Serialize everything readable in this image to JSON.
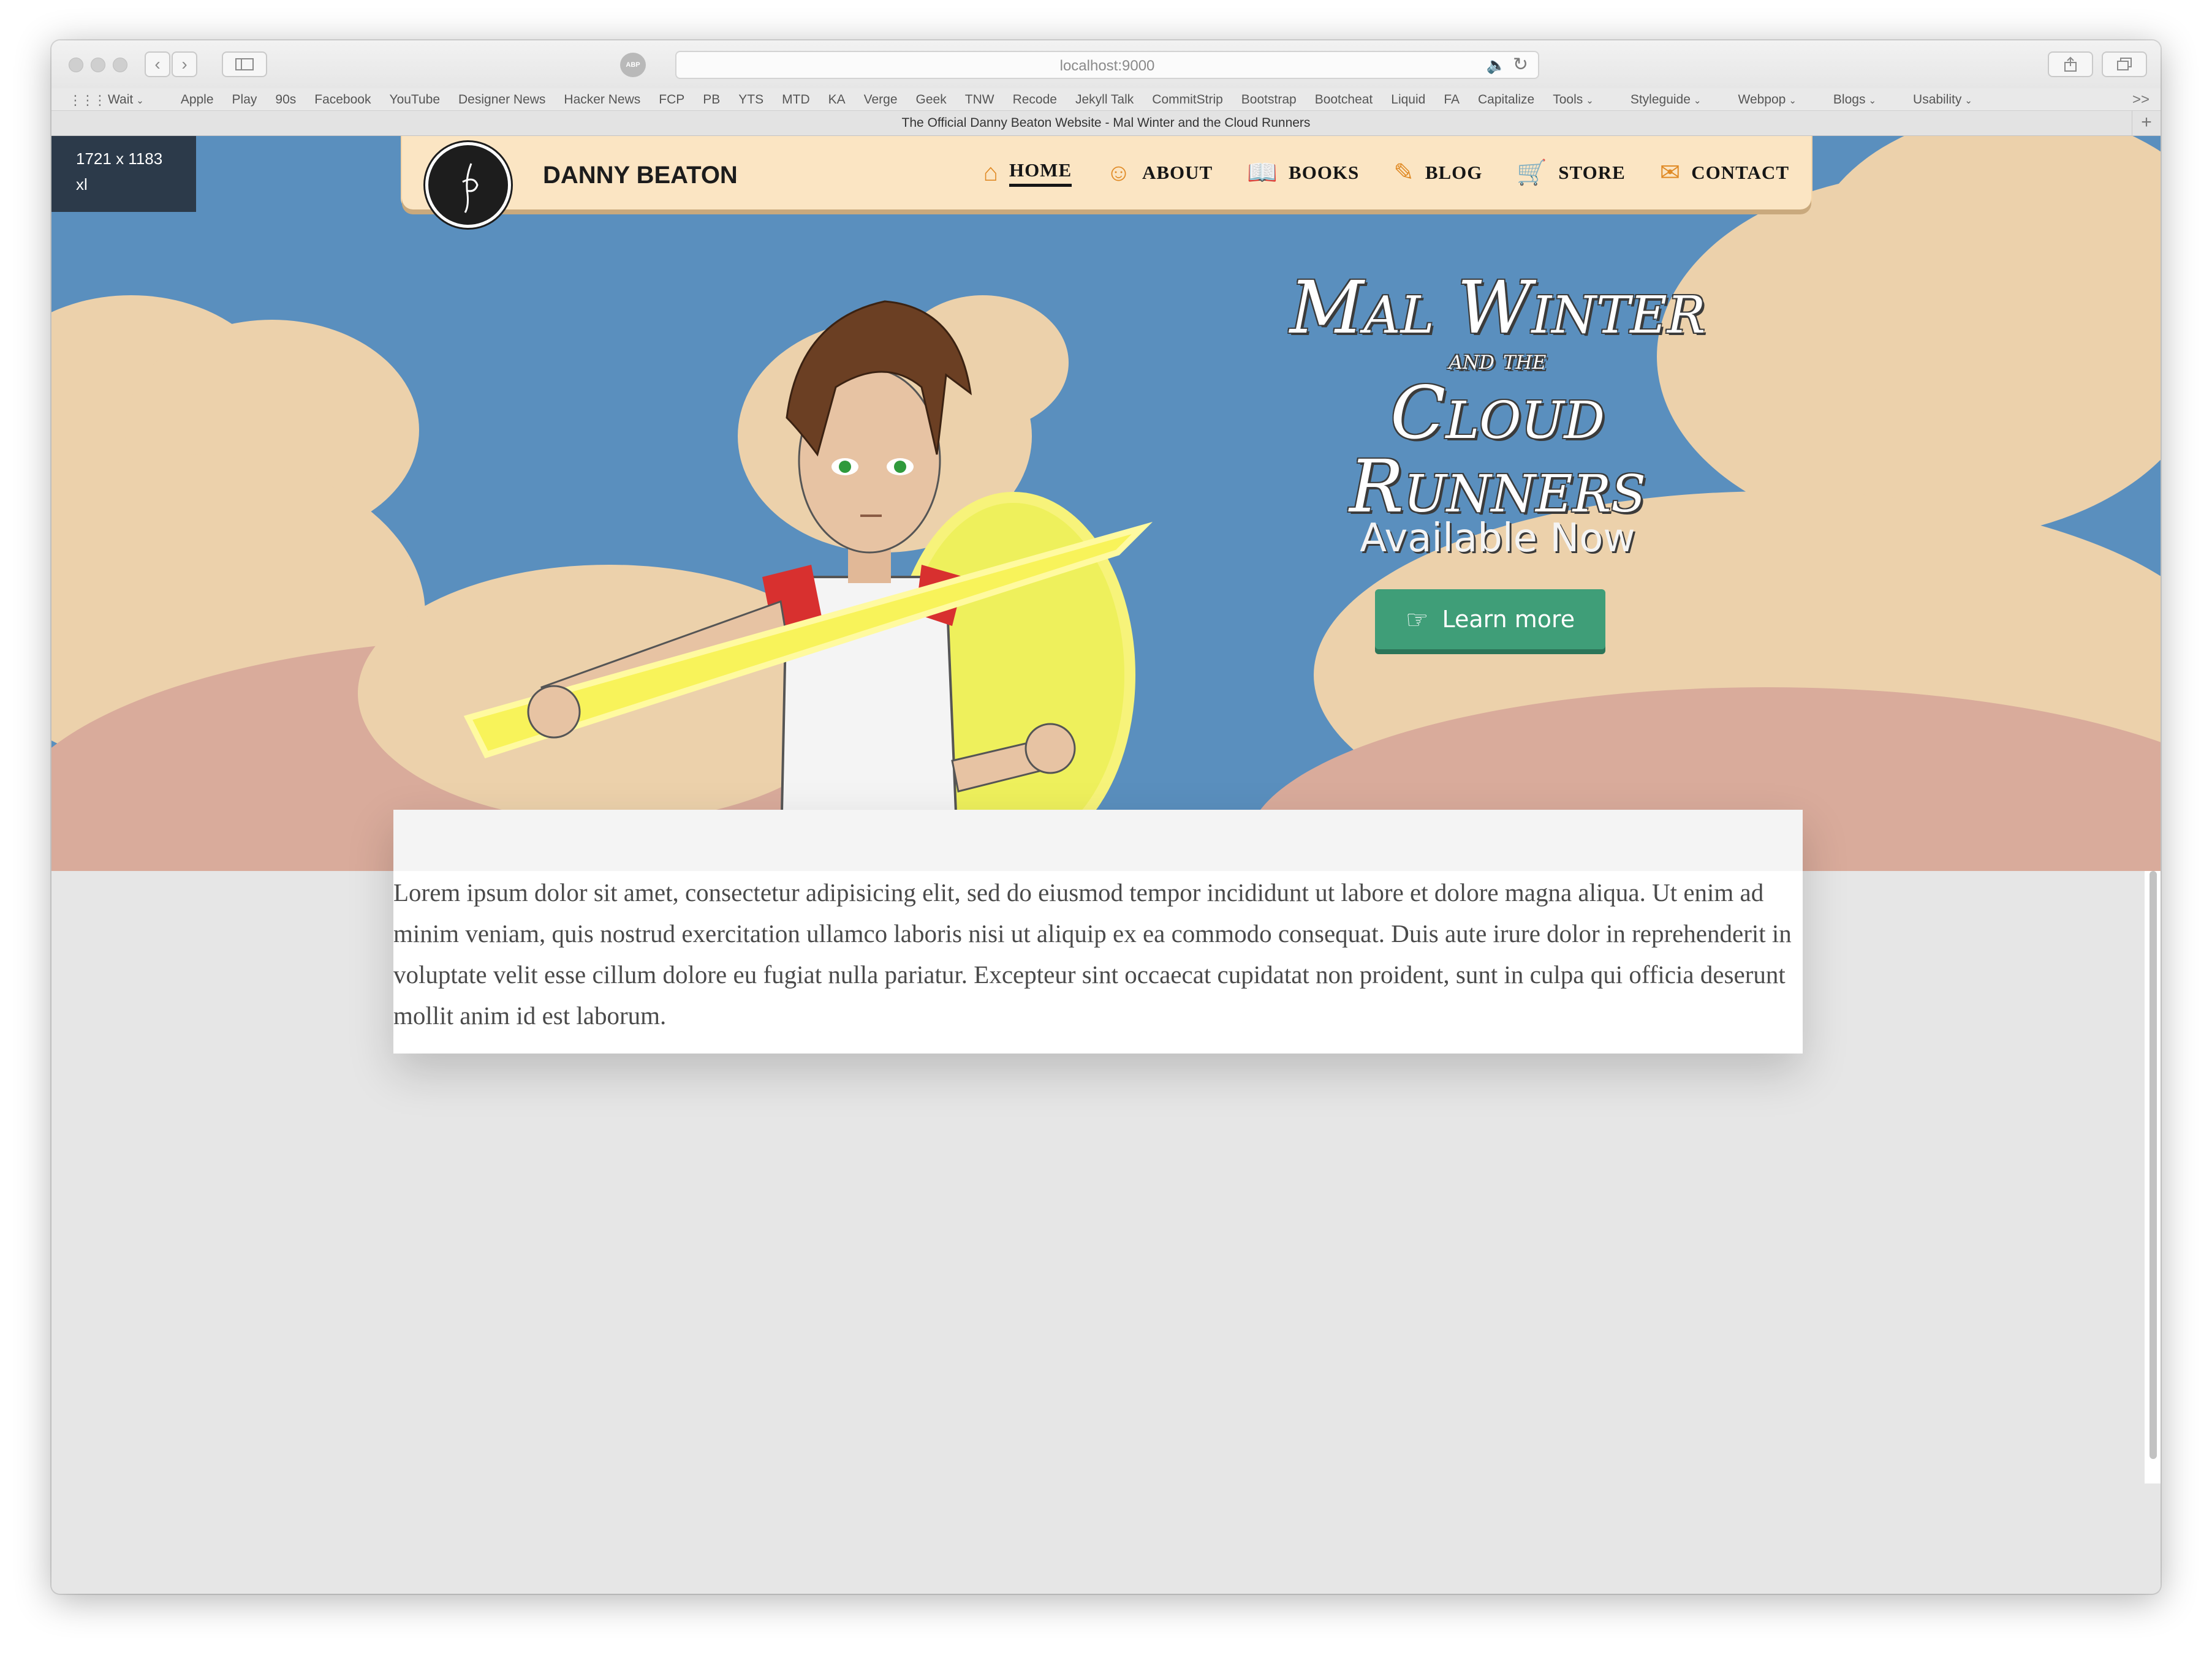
{
  "browser": {
    "url": "localhost:9000",
    "tab_title": "The Official Danny Beaton Website - Mal Winter and the Cloud Runners",
    "favorites": [
      "Wait",
      "Apple",
      "Play",
      "90s",
      "Facebook",
      "YouTube",
      "Designer News",
      "Hacker News",
      "FCP",
      "PB",
      "YTS",
      "MTD",
      "KA",
      "Verge",
      "Geek",
      "TNW",
      "Recode",
      "Jekyll Talk",
      "CommitStrip",
      "Bootstrap",
      "Bootcheat",
      "Liquid",
      "FA",
      "Capitalize",
      "Tools",
      "Styleguide",
      "Webpop",
      "Blogs",
      "Usability"
    ],
    "favorites_more": ">>",
    "abp_label": "ABP"
  },
  "breakpoint": {
    "size": "1721 x 1183",
    "label": "xl"
  },
  "site": {
    "brand": "DANNY BEATON",
    "nav": [
      {
        "label": "HOME",
        "icon": "home-icon",
        "glyph": "⌂",
        "active": true
      },
      {
        "label": "ABOUT",
        "icon": "user-icon",
        "glyph": "☺",
        "active": false
      },
      {
        "label": "BOOKS",
        "icon": "book-icon",
        "glyph": "📖",
        "active": false
      },
      {
        "label": "BLOG",
        "icon": "pen-icon",
        "glyph": "✎",
        "active": false
      },
      {
        "label": "STORE",
        "icon": "cart-icon",
        "glyph": "🛒",
        "active": false
      },
      {
        "label": "CONTACT",
        "icon": "envelope-icon",
        "glyph": "✉",
        "active": false
      }
    ]
  },
  "hero": {
    "title_line1": "Mal Winter",
    "title_line2": "and the",
    "title_line3": "Cloud Runners",
    "subtitle": "Available Now",
    "button_label": "Learn more",
    "button_icon": "hand-pointing-icon",
    "button_color": "#3f9e78",
    "sky_color": "#5a8fbe"
  },
  "body_text": "Lorem ipsum dolor sit amet, consectetur adipisicing elit, sed do eiusmod tempor incididunt ut labore et dolore magna aliqua. Ut enim ad minim veniam, quis nostrud exercitation ullamco laboris nisi ut aliquip ex ea commodo consequat. Duis aute irure dolor in reprehenderit in voluptate velit esse cillum dolore eu fugiat nulla pariatur. Excepteur sint occaecat cupidatat non proident, sunt in culpa qui officia deserunt mollit anim id est laborum."
}
